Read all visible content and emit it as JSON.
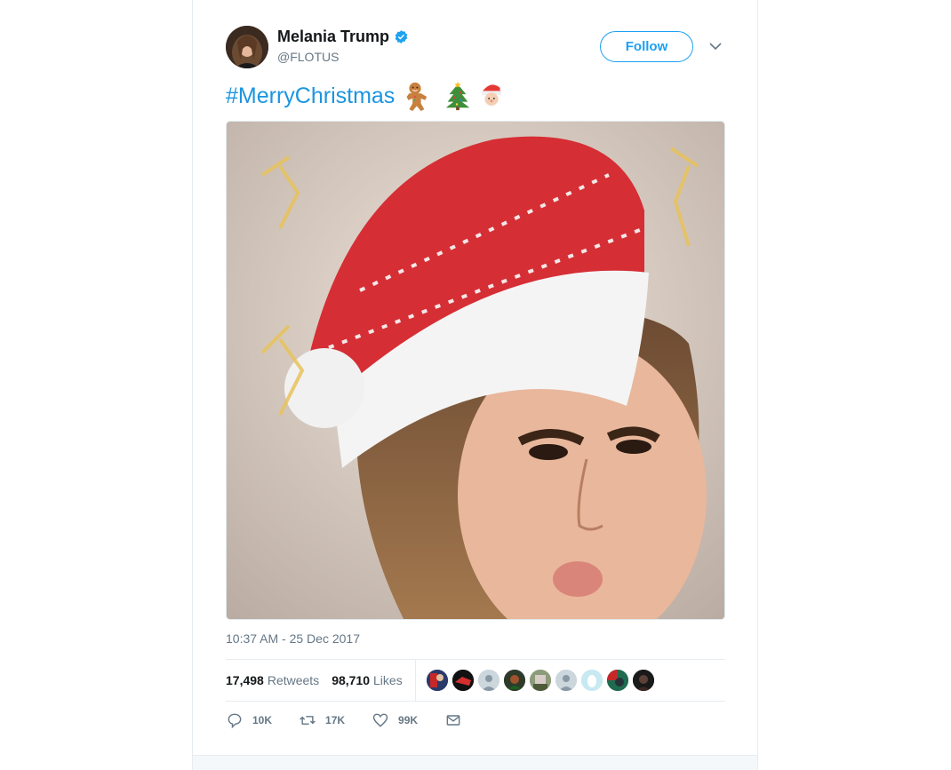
{
  "author": {
    "name": "Melania Trump",
    "handle": "@FLOTUS",
    "verified_icon": "verified-badge-icon"
  },
  "header": {
    "follow_label": "Follow",
    "caret_icon": "chevron-down-icon"
  },
  "tweet": {
    "hashtag": "#MerryChristmas",
    "emojis": [
      "gingerbread-icon",
      "christmas-tree-icon",
      "santa-icon"
    ],
    "photo_icon": "tweet-photo"
  },
  "timestamp": "10:37 AM - 25 Dec 2017",
  "stats": {
    "retweets_count": "17,498",
    "retweets_label": "Retweets",
    "likes_count": "98,710",
    "likes_label": "Likes",
    "likers_avatars": 9
  },
  "actions": {
    "reply_count": "10K",
    "retweet_count": "17K",
    "like_count": "99K",
    "reply_icon": "reply-icon",
    "retweet_icon": "retweet-icon",
    "like_icon": "heart-icon",
    "message_icon": "envelope-icon"
  },
  "colors": {
    "accent": "#1da1f2",
    "hashtag": "#1b95e0",
    "muted": "#657786",
    "text": "#14171a"
  }
}
